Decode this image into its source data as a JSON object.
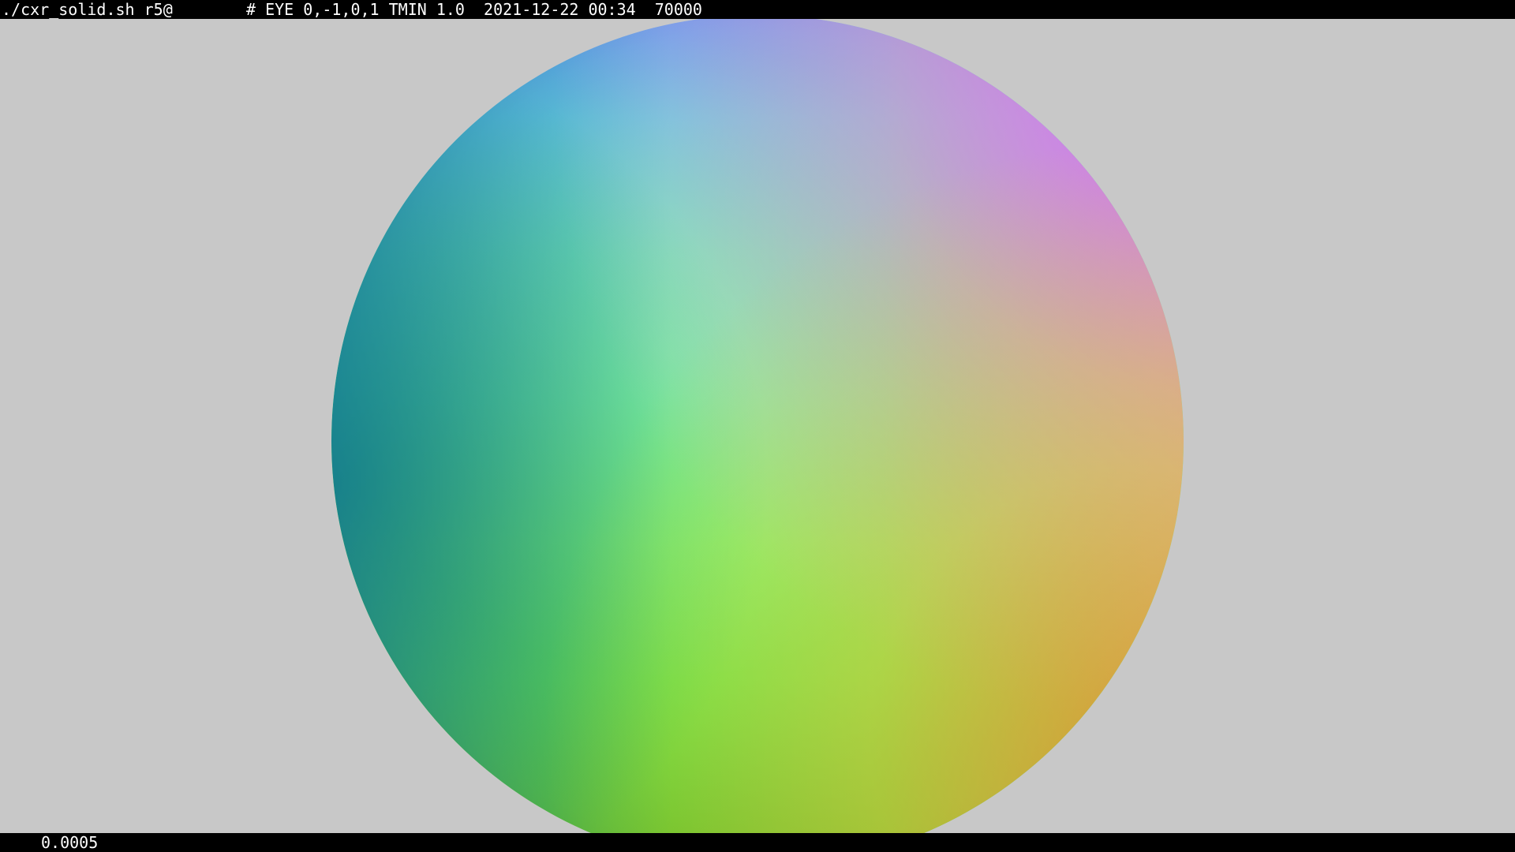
{
  "topbar": {
    "command": "./cxr_solid.sh r5@",
    "meta": "# EYE 0,-1,0,1 TMIN 1.0  2021-12-22 00:34  70000"
  },
  "bottombar": {
    "value": "0.0005"
  },
  "viewport": {
    "background_color": "#c8c8c8",
    "object": "sphere-icon"
  }
}
